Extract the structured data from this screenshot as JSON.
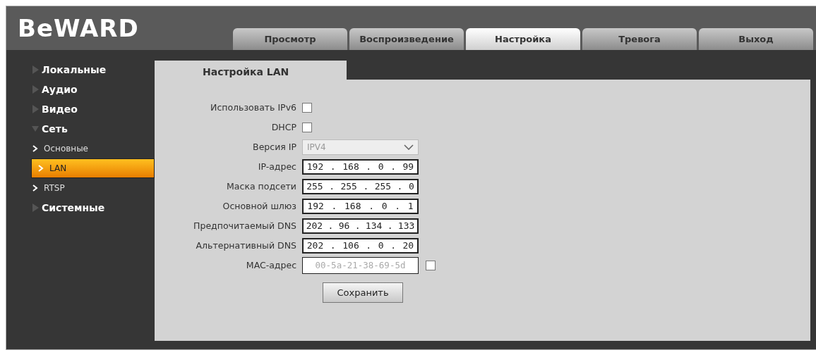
{
  "logo": "BeWARD",
  "tabs": [
    {
      "label": "Просмотр",
      "selected": false
    },
    {
      "label": "Воспроизведение",
      "selected": false
    },
    {
      "label": "Настройка",
      "selected": true
    },
    {
      "label": "Тревога",
      "selected": false
    },
    {
      "label": "Выход",
      "selected": false
    }
  ],
  "sidebar": {
    "items": [
      {
        "label": "Локальные",
        "expanded": false
      },
      {
        "label": "Аудио",
        "expanded": false
      },
      {
        "label": "Видео",
        "expanded": false
      },
      {
        "label": "Сеть",
        "expanded": true,
        "children": [
          {
            "label": "Основные",
            "selected": false
          },
          {
            "label": "LAN",
            "selected": true
          },
          {
            "label": "RTSP",
            "selected": false
          }
        ]
      },
      {
        "label": "Системные",
        "expanded": false
      }
    ]
  },
  "panel": {
    "title": "Настройка LAN",
    "rows": [
      {
        "kind": "checkbox",
        "label": "Использовать IPv6",
        "checked": false
      },
      {
        "kind": "checkbox",
        "label": "DHCP",
        "checked": false
      },
      {
        "kind": "select",
        "label": "Версия IP",
        "value": "IPV4",
        "disabled": true
      },
      {
        "kind": "ip",
        "label": "IP-адрес",
        "octets": [
          "192",
          "168",
          "0",
          "99"
        ]
      },
      {
        "kind": "ip",
        "label": "Маска подсети",
        "octets": [
          "255",
          "255",
          "255",
          "0"
        ]
      },
      {
        "kind": "ip",
        "label": "Основной шлюз",
        "octets": [
          "192",
          "168",
          "0",
          "1"
        ]
      },
      {
        "kind": "ip",
        "label": "Предпочитаемый DNS",
        "octets": [
          "202",
          "96",
          "134",
          "133"
        ]
      },
      {
        "kind": "ip",
        "label": "Альтернативный DNS",
        "octets": [
          "202",
          "106",
          "0",
          "20"
        ]
      },
      {
        "kind": "mac",
        "label": "MAC-адрес",
        "value": "00-5a-21-38-69-5d",
        "disabled": true,
        "checked": false
      }
    ],
    "separator": ".",
    "save_button": "Сохранить"
  }
}
